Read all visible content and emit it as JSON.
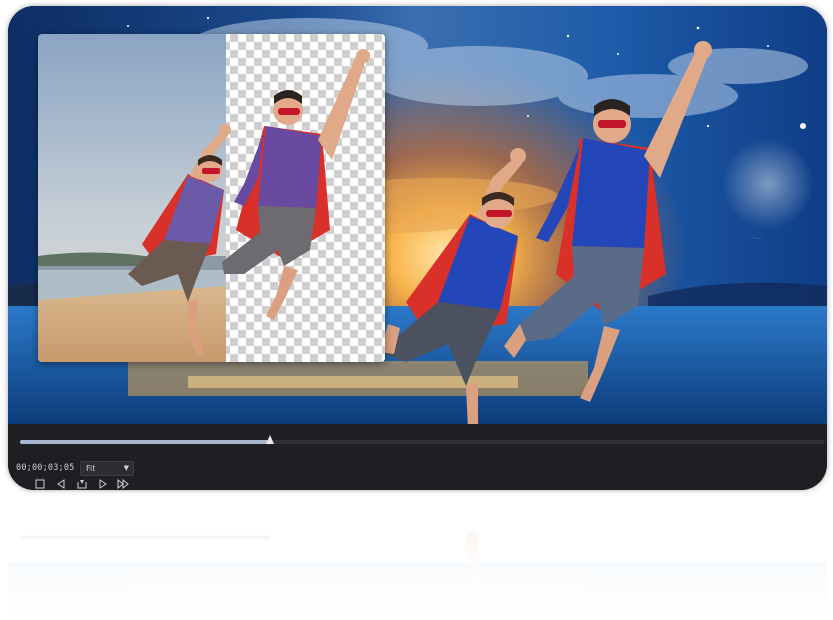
{
  "player": {
    "timecode": "00;00;03;05",
    "fit_select": {
      "value": "Fit",
      "caret": "▼"
    },
    "progress_fraction": 0.31
  },
  "controls": [
    {
      "name": "stop-button",
      "icon": "square-icon"
    },
    {
      "name": "step-back-button",
      "icon": "step-back-icon"
    },
    {
      "name": "mark-button",
      "icon": "mark-icon"
    },
    {
      "name": "play-button",
      "icon": "play-icon"
    },
    {
      "name": "step-forward-button",
      "icon": "step-forward-icon"
    }
  ],
  "colors": {
    "panel": "#1e1f22",
    "timeline_fill": "#a7b8d0",
    "cape": "#d9302a",
    "shirt": "#2346b8"
  }
}
